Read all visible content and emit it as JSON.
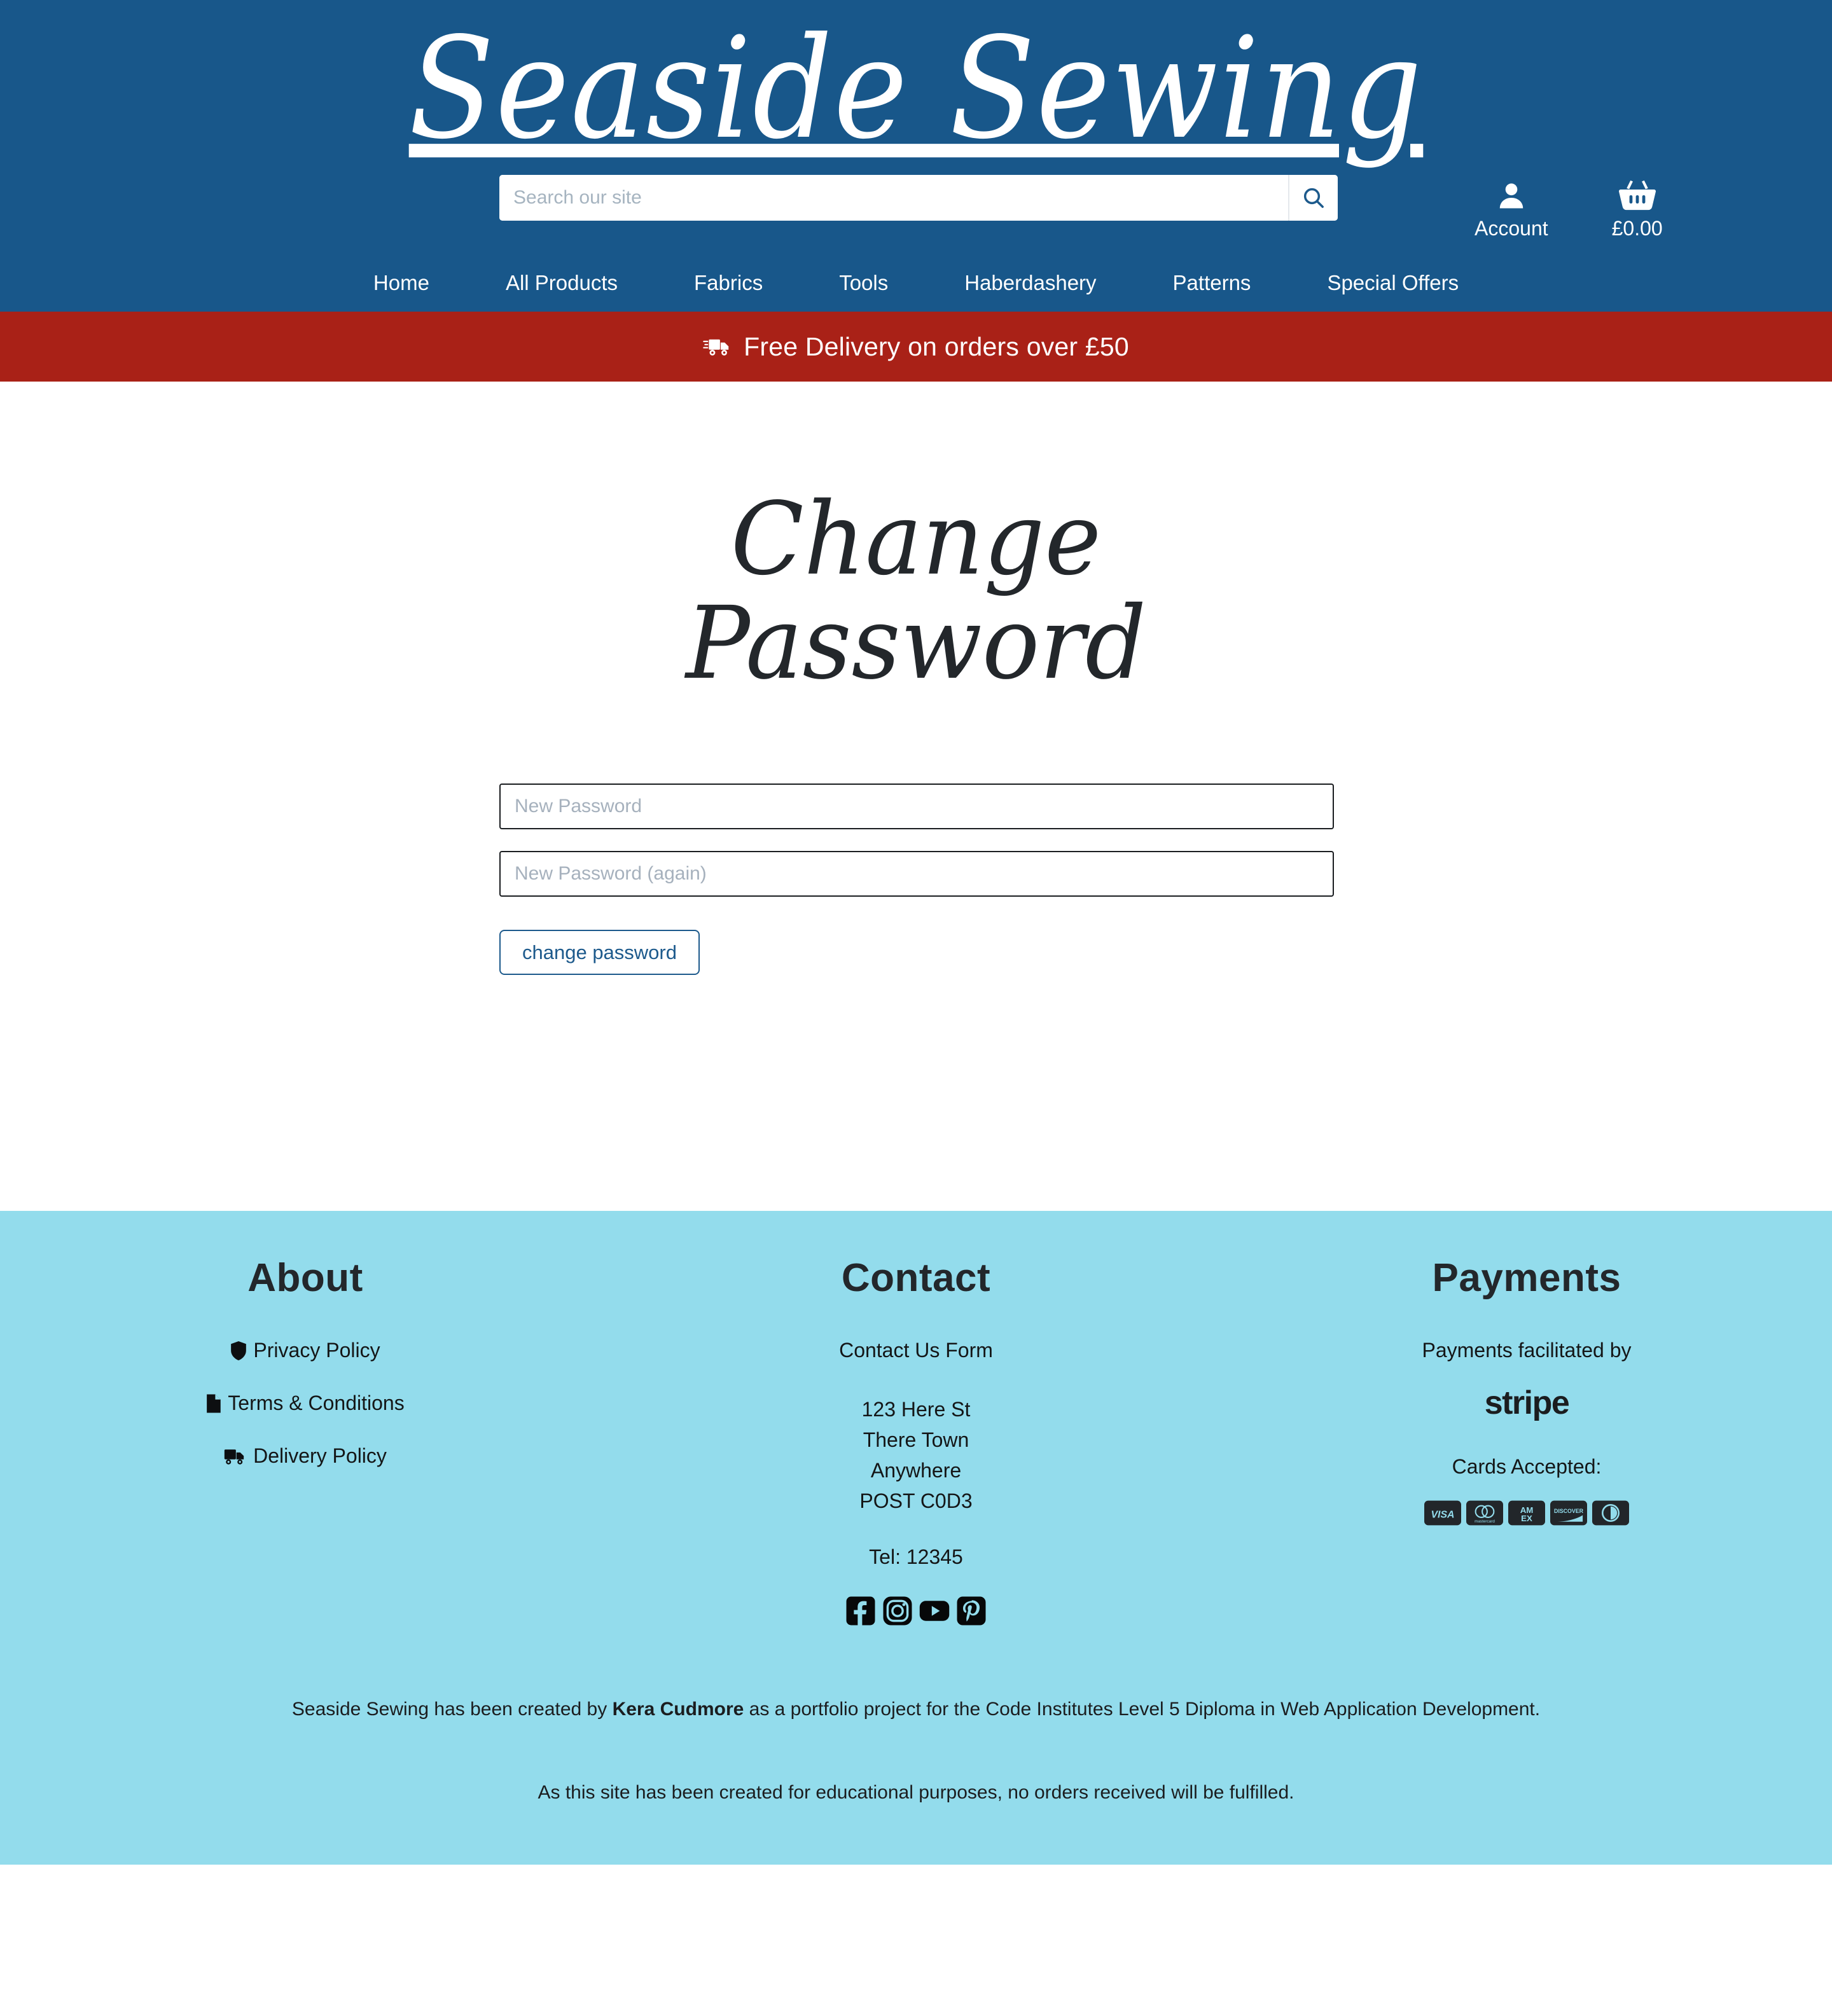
{
  "brand": {
    "name": "Seaside Sewing"
  },
  "search": {
    "placeholder": "Search our site",
    "value": "",
    "icon": "search-icon",
    "submit_label": "Search"
  },
  "header_utility": {
    "account": {
      "label": "Account",
      "icon": "user-icon"
    },
    "basket": {
      "label": "£0.00",
      "icon": "basket-icon"
    }
  },
  "nav": {
    "items": [
      {
        "label": "Home"
      },
      {
        "label": "All Products"
      },
      {
        "label": "Fabrics"
      },
      {
        "label": "Tools"
      },
      {
        "label": "Haberdashery"
      },
      {
        "label": "Patterns"
      },
      {
        "label": "Special Offers"
      }
    ]
  },
  "banner": {
    "icon": "truck-icon",
    "text": "Free Delivery on orders over £50"
  },
  "main": {
    "heading": "Change Password",
    "form": {
      "new_password": {
        "placeholder": "New Password",
        "value": ""
      },
      "new_password_again": {
        "placeholder": "New Password (again)",
        "value": ""
      },
      "submit_label": "change password"
    }
  },
  "footer": {
    "about": {
      "heading": "About",
      "links": [
        {
          "label": "Privacy Policy",
          "icon": "shield-icon"
        },
        {
          "label": "Terms & Conditions",
          "icon": "file-icon"
        },
        {
          "label": "Delivery Policy",
          "icon": "truck-icon"
        }
      ]
    },
    "contact": {
      "heading": "Contact",
      "form_link": "Contact Us Form",
      "address": [
        "123 Here St",
        "There Town",
        "Anywhere",
        "POST C0D3"
      ],
      "telephone": "Tel: 12345",
      "socials": [
        {
          "name": "facebook-icon"
        },
        {
          "name": "instagram-icon"
        },
        {
          "name": "youtube-icon"
        },
        {
          "name": "pinterest-icon"
        }
      ]
    },
    "payments": {
      "heading": "Payments",
      "facilitated_text": "Payments facilitated by",
      "provider": "stripe",
      "cards_label": "Cards Accepted:",
      "cards": [
        {
          "name": "visa-card-icon",
          "label": "VISA"
        },
        {
          "name": "mastercard-card-icon",
          "label": "mastercard"
        },
        {
          "name": "amex-card-icon",
          "label": "AMEX"
        },
        {
          "name": "discover-card-icon",
          "label": "DISCOVER"
        },
        {
          "name": "diners-club-card-icon",
          "label": "Diners Club"
        }
      ]
    },
    "credit": {
      "line1_before": "Seaside Sewing has been created by ",
      "line1_name": "Kera Cudmore",
      "line1_after": " as a portfolio project for the Code Institutes Level 5 Diploma in Web Application Development.",
      "line2": "As this site has been created for educational purposes, no orders received will be fulfilled."
    }
  },
  "colors": {
    "header_blue": "#18578a",
    "banner_red": "#a92117",
    "footer_blue": "#93dcec",
    "button_blue": "#1d5a8c",
    "text_dark": "#23272b"
  }
}
